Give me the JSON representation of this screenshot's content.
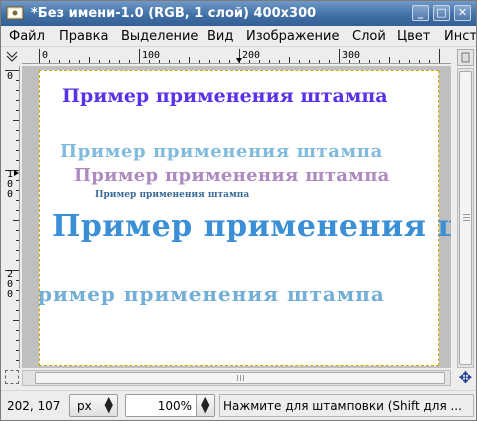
{
  "window": {
    "title": "*Без имени-1.0 (RGB, 1 слой) 400x300",
    "minimize": "_",
    "maximize": "□",
    "close": "✕"
  },
  "menu": [
    "Файл",
    "Правка",
    "Выделение",
    "Вид",
    "Изображение",
    "Слой",
    "Цвет",
    "Инст"
  ],
  "rulers": {
    "horizontal": [
      "0",
      "100",
      "200",
      "300"
    ],
    "vertical": [
      "0",
      "100",
      "200"
    ]
  },
  "canvas": {
    "title_text": "Пример применения штампа",
    "stamp_1": "Пример применения штампа",
    "stamp_2": "Пример применения штампа",
    "stamp_3": "Пример применения штампа",
    "stamp_4": "Пример применения ш",
    "stamp_5": "ример применения штампа"
  },
  "status": {
    "coords": "202, 107",
    "unit": "px",
    "zoom": "100%",
    "hint": "Нажмите для штамповки (Shift для ..."
  },
  "colors": {
    "title_accent": "#5a32e6",
    "stamp_blue": "#3a8fd6",
    "stamp_purple": "#8b5aa6",
    "selection_border": "#d4a600"
  },
  "icons": [
    "app-icon",
    "minimize-icon",
    "maximize-icon",
    "close-icon",
    "navigate-icon",
    "quick-mask-icon",
    "ruler-corner-icon",
    "nav-arrow-icon"
  ]
}
